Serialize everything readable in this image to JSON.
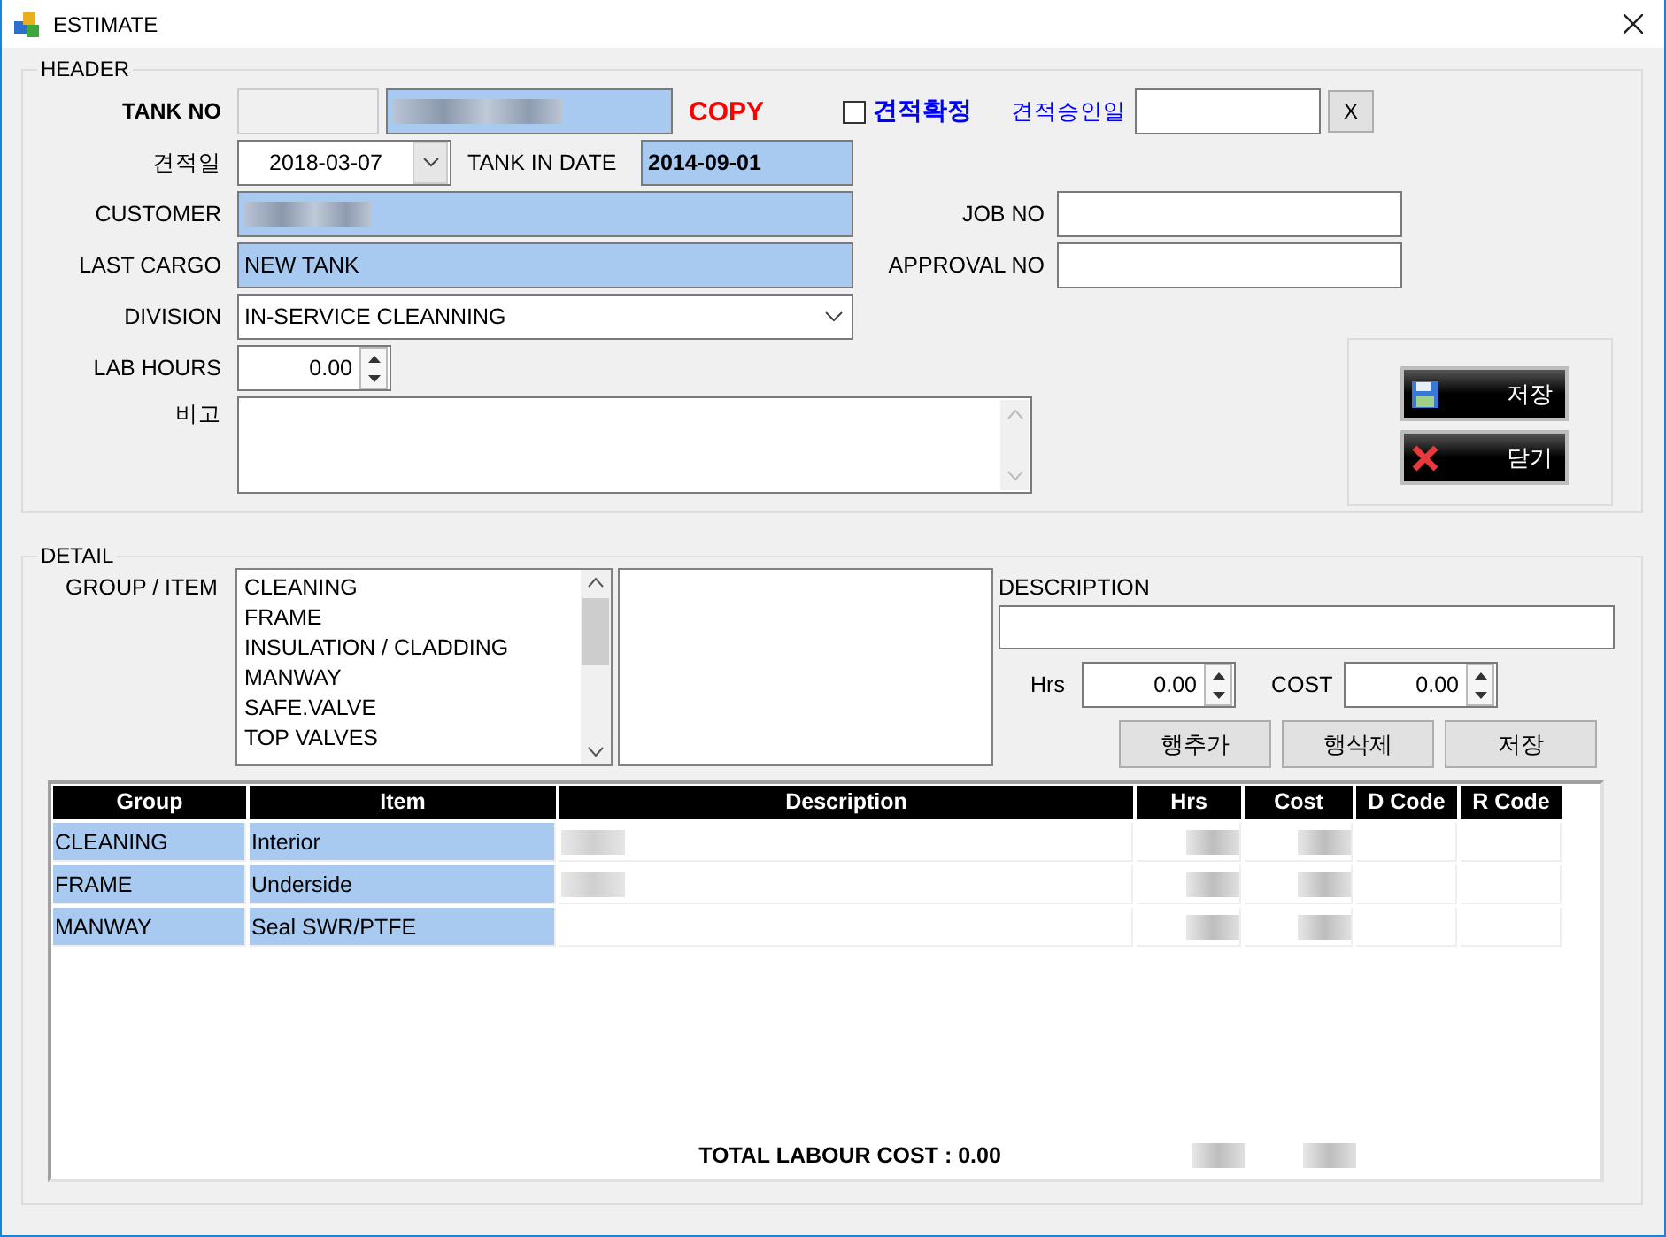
{
  "window": {
    "title": "ESTIMATE"
  },
  "header": {
    "legend": "HEADER",
    "tank_no": {
      "label": "TANK NO",
      "copy": "COPY"
    },
    "confirm": {
      "label": "견적확정",
      "checked": false
    },
    "approval_date": {
      "label": "견적승인일",
      "clear": "X"
    },
    "estimate_date": {
      "label": "견적일",
      "value": "2018-03-07"
    },
    "tank_in_date": {
      "label": "TANK IN DATE",
      "value": "2014-09-01"
    },
    "customer": {
      "label": "CUSTOMER"
    },
    "job_no": {
      "label": "JOB NO"
    },
    "last_cargo": {
      "label": "LAST CARGO",
      "value": "NEW TANK"
    },
    "approval_no": {
      "label": "APPROVAL NO"
    },
    "division": {
      "label": "DIVISION",
      "value": "IN-SERVICE CLEANNING"
    },
    "lab_hours": {
      "label": "LAB HOURS",
      "value": "0.00"
    },
    "remarks": {
      "label": "비고"
    },
    "buttons": [
      {
        "kind": "save",
        "label": "저장"
      },
      {
        "kind": "close",
        "label": "닫기"
      }
    ]
  },
  "detail": {
    "legend": "DETAIL",
    "group_item_label": "GROUP / ITEM",
    "groups": [
      "CLEANING",
      "FRAME",
      "INSULATION / CLADDING",
      "MANWAY",
      "SAFE.VALVE",
      "TOP VALVES"
    ],
    "description": {
      "label": "DESCRIPTION"
    },
    "hrs": {
      "label": "Hrs",
      "value": "0.00"
    },
    "cost": {
      "label": "COST",
      "value": "0.00"
    },
    "buttons": [
      "행추가",
      "행삭제",
      "저장"
    ],
    "table": {
      "columns": [
        "Group",
        "Item",
        "Description",
        "Hrs",
        "Cost",
        "D Code",
        "R Code"
      ],
      "rows": [
        {
          "group": "CLEANING",
          "item": "Interior",
          "description_blurred": true
        },
        {
          "group": "FRAME",
          "item": "Underside",
          "description_blurred": true
        },
        {
          "group": "MANWAY",
          "item": "Seal SWR/PTFE",
          "description_blurred": false
        }
      ],
      "total": "TOTAL LABOUR COST : 0.00"
    }
  }
}
